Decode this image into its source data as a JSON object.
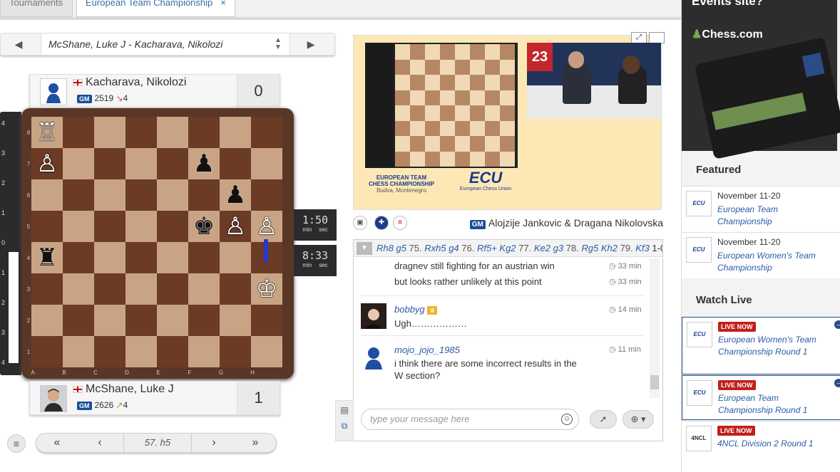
{
  "tabs": [
    {
      "label": "Tournaments"
    },
    {
      "label": "European Team Championship",
      "close": "×"
    }
  ],
  "game_selector": {
    "prev": "◀",
    "next": "▶",
    "name": "McShane, Luke J - Kacharava, Nikolozi",
    "updown": "▲▼"
  },
  "top_player": {
    "name": "Kacharava, Nikolozi",
    "title": "GM",
    "rating": "2519",
    "change_arrow": "↘",
    "change": "4",
    "change_color": "#d9443a",
    "score": "0"
  },
  "bottom_player": {
    "name": "McShane, Luke J",
    "title": "GM",
    "rating": "2626",
    "change_arrow": "↗",
    "change": "4",
    "change_color": "#5fae3a",
    "score": "1"
  },
  "board": {
    "ranks": [
      "8",
      "7",
      "6",
      "5",
      "4",
      "3",
      "2",
      "1"
    ],
    "files": [
      "A",
      "B",
      "C",
      "D",
      "E",
      "F",
      "G",
      "H"
    ],
    "pieces": [
      {
        "sq": "a8",
        "glyph": "♖",
        "color": "white"
      },
      {
        "sq": "a7",
        "glyph": "♙",
        "color": "white"
      },
      {
        "sq": "f7",
        "glyph": "♟",
        "color": "black"
      },
      {
        "sq": "g6",
        "glyph": "♟",
        "color": "black"
      },
      {
        "sq": "f5",
        "glyph": "♚",
        "color": "black"
      },
      {
        "sq": "g5",
        "glyph": "♙",
        "color": "white"
      },
      {
        "sq": "h5",
        "glyph": "♙",
        "color": "white"
      },
      {
        "sq": "a4",
        "glyph": "♜",
        "color": "black"
      },
      {
        "sq": "h3",
        "glyph": "♔",
        "color": "white"
      }
    ]
  },
  "eval_bar": {
    "ticks": [
      "4",
      "3",
      "2",
      "1",
      "0",
      "1",
      "2",
      "3",
      "4"
    ],
    "white_fraction": 0.46
  },
  "clocks": {
    "top": {
      "time": "1:50",
      "min": "min",
      "sec": "sec"
    },
    "bottom": {
      "time": "8:33",
      "min": "min",
      "sec": "sec"
    }
  },
  "navigation": {
    "menu": "≡",
    "first": "«",
    "prev": "‹",
    "current_move": "57. h5",
    "next": "›",
    "last": "»"
  },
  "video": {
    "title_line1": "EUROPEAN TEAM",
    "title_line2": "CHESS CHAMPIONSHIP",
    "title_line3": "Budva, Montenegro",
    "ecu_logo": "ECU",
    "ecu_sub": "European Chess Union"
  },
  "commentators": {
    "title": "GM",
    "names": "Alojzije Jankovic & Dragana Nikolovska"
  },
  "moves_line": [
    {
      "num": "",
      "move": "Rh8"
    },
    {
      "num": "",
      "move": "g5"
    },
    {
      "num": "75.",
      "move": "Rxh5"
    },
    {
      "num": "",
      "move": "g4"
    },
    {
      "num": "76.",
      "move": "Rf5+"
    },
    {
      "num": "",
      "move": "Kg2"
    },
    {
      "num": "77.",
      "move": "Ke2"
    },
    {
      "num": "",
      "move": "g3"
    },
    {
      "num": "78.",
      "move": "Rg5"
    },
    {
      "num": "",
      "move": "Kh2"
    },
    {
      "num": "79.",
      "move": "Kf3"
    },
    {
      "num": "",
      "move": "1-0"
    }
  ],
  "chat": {
    "messages": [
      {
        "user": "",
        "lines": [
          "dragnev still fighting for an austrian win"
        ],
        "time": "33 min"
      },
      {
        "user": "",
        "lines": [
          "but looks rather unlikely at this point"
        ],
        "time": "33 min"
      },
      {
        "user": "bobbyg",
        "lines": [
          "Ugh………………"
        ],
        "time": "14 min"
      },
      {
        "user": "mojo_jojo_1985",
        "lines": [
          "i think there are some incorrect results in the",
          "W section?"
        ],
        "time": "11 min"
      }
    ],
    "placeholder": "type your message here"
  },
  "sidebar": {
    "ad_title": "Events site?",
    "ad_logo": "Chess.com",
    "featured_heading": "Featured",
    "featured": [
      {
        "date": "November 11-20",
        "name": "European Team Championship",
        "logo": "ECU"
      },
      {
        "date": "November 11-20",
        "name": "European Women's Team Championship",
        "logo": "ECU"
      }
    ],
    "watch_heading": "Watch Live",
    "live": [
      {
        "badge": "LIVE NOW",
        "name": "European Women's Team Championship Round 1",
        "logo": "ECU"
      },
      {
        "badge": "LIVE NOW",
        "name": "European Team Championship Round 1",
        "logo": "ECU"
      },
      {
        "badge": "LIVE NOW",
        "name": "4NCL Division 2 Round 1",
        "logo": "4NCL"
      }
    ]
  }
}
